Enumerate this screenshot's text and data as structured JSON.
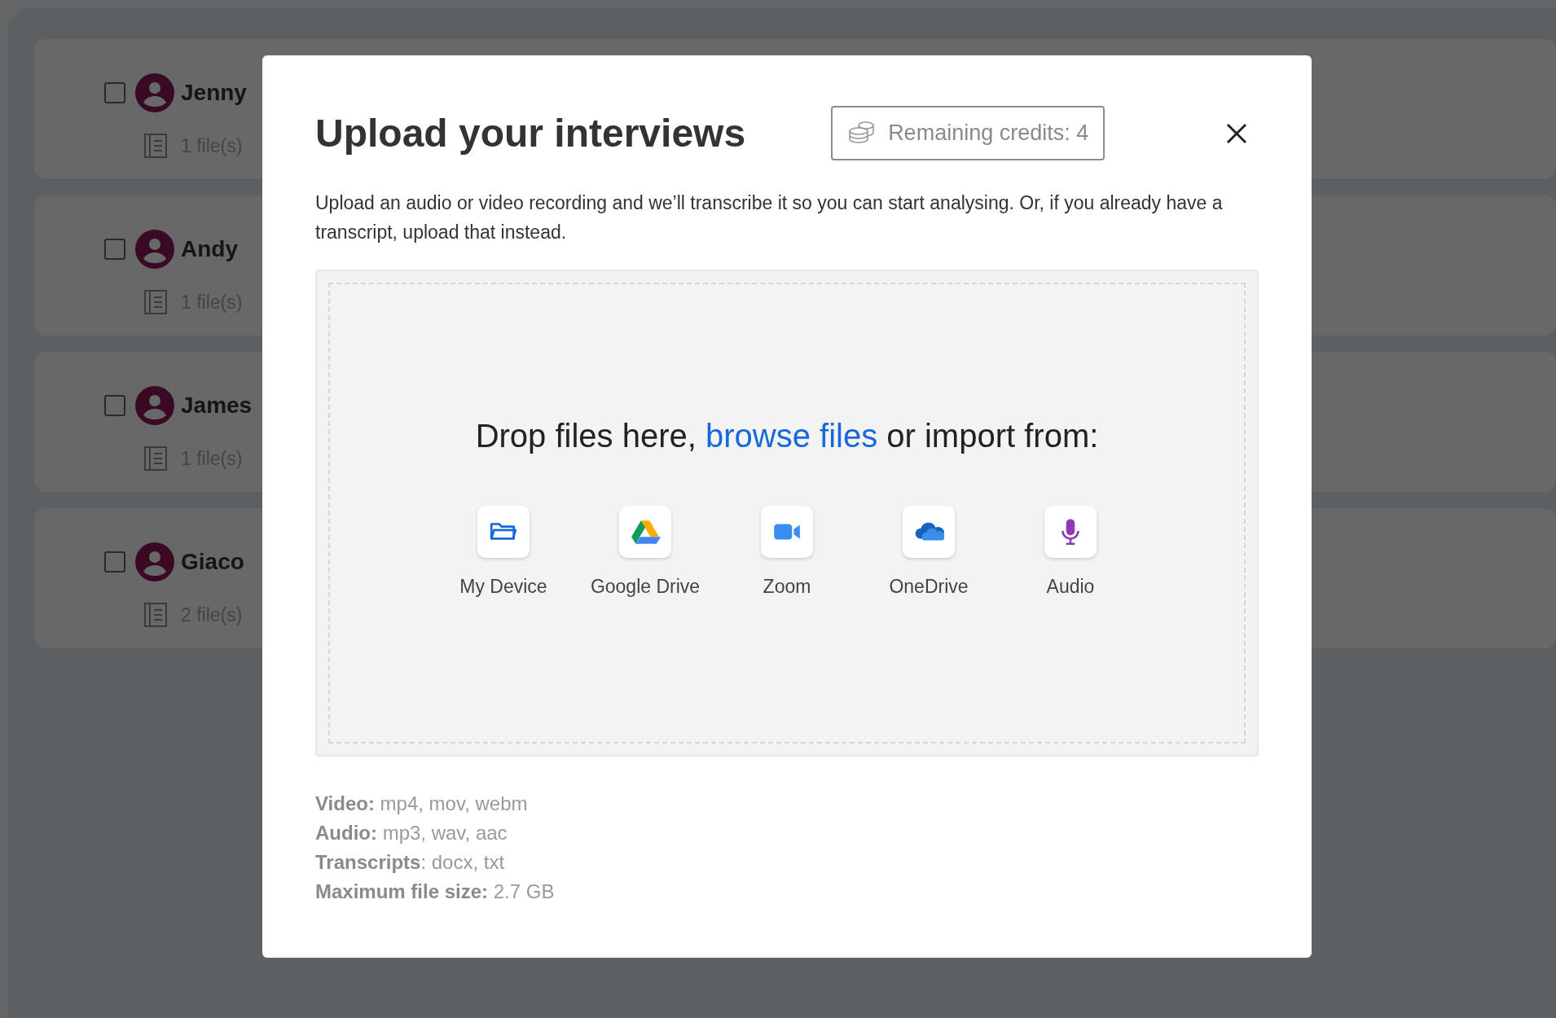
{
  "background": {
    "rows": [
      {
        "name": "Jenny",
        "files": "1 file(s)",
        "checked": false
      },
      {
        "name": "Andy",
        "files": "1 file(s)",
        "checked": false
      },
      {
        "name": "James",
        "files": "1 file(s)",
        "checked": false
      },
      {
        "name": "Giaco",
        "files": "2 file(s)",
        "checked": false
      }
    ]
  },
  "modal": {
    "title": "Upload your interviews",
    "credits": "Remaining credits: 4",
    "description": "Upload an audio or video recording and we’ll transcribe it so you can start analysing. Or, if you already have a transcript, upload that instead.",
    "dropzone": {
      "prefix": "Drop files here,",
      "link": "browse files",
      "suffix": "or import from:"
    },
    "sources": [
      {
        "label": "My Device",
        "kind": "device"
      },
      {
        "label": "Google Drive",
        "kind": "drive"
      },
      {
        "label": "Zoom",
        "kind": "zoom"
      },
      {
        "label": "OneDrive",
        "kind": "onedrive"
      },
      {
        "label": "Audio",
        "kind": "audio"
      }
    ],
    "formats": [
      "**Video:** mp4, mov, webm",
      "**Audio:** mp3, wav, aac",
      "**Transcripts**: docx, txt",
      "**Maximum file size:** 2.7 GB"
    ]
  }
}
